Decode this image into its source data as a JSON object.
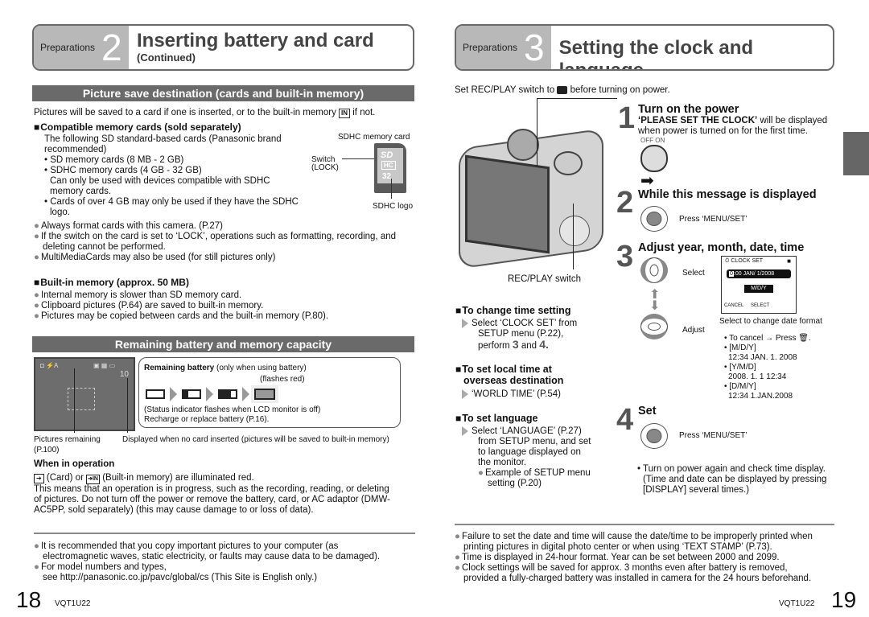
{
  "left_page": {
    "header": {
      "section": "Preparations",
      "number": "2",
      "title": "Inserting battery and card",
      "subtitle": "(Continued)"
    },
    "section1": {
      "bar": "Picture save destination (cards and built-in memory)",
      "intro": "Pictures will be saved to a card if one is inserted, or to the built-in memory",
      "intro_end": "if not.",
      "compatible_title": "Compatible memory cards (sold separately)",
      "compatible_lines": [
        "The following SD standard-based cards (Panasonic brand",
        "recommended)",
        "• SD memory cards (8 MB - 2 GB)",
        "• SDHC memory cards (4 GB - 32 GB)",
        "Can only be used with devices compatible with SDHC",
        "memory cards.",
        "• Cards of over 4 GB may only be used if they have the SDHC",
        "logo."
      ],
      "card_labels": {
        "top": "SDHC memory card",
        "switch": "Switch",
        "lock": "(LOCK)",
        "logo": "SDHC logo",
        "capacity": "32"
      },
      "notes": [
        "Always format cards with this camera. (P.27)",
        "If the switch on the card is set to ‘LOCK’, operations such as formatting, recording, and",
        "deleting cannot be performed.",
        "MultiMediaCards may also be used (for still pictures only)"
      ],
      "builtin_title": "Built-in memory (approx. 50 MB)",
      "builtin_notes": [
        "Internal memory is slower than SD memory card.",
        "Clipboard pictures (P.64) are saved to built-in memory.",
        "Pictures may be copied between cards and the built-in memory (P.80)."
      ]
    },
    "section2": {
      "bar": "Remaining battery and memory capacity",
      "lcd_count": "10",
      "battery_title": "Remaining battery",
      "battery_title_rest": "(only when using battery)",
      "flashes": "(flashes red)",
      "status_line": "(Status indicator flashes when LCD monitor is off)",
      "recharge": "Recharge or replace battery (P.16).",
      "pictures_remaining": "Pictures remaining",
      "pictures_page": "(P.100)",
      "no_card": "Displayed when no card inserted (pictures will be saved to built-in memory)",
      "operation_title": "When in operation",
      "operation_line1": "(Card) or",
      "operation_line1b": "(Built-in memory) are illuminated red.",
      "operation_text": [
        "This means that an operation is in progress, such as the recording, reading, or deleting",
        "of pictures. Do not turn off the power or remove the battery, card, or AC adaptor (DMW-",
        "AC5PP, sold separately) (this may cause damage to or loss of data)."
      ]
    },
    "footer_notes": [
      "It is recommended that you copy important pictures to your computer (as",
      "electromagnetic waves, static electricity, or faults may cause data to be damaged).",
      "For model numbers and types,",
      "see http://panasonic.co.jp/pavc/global/cs (This Site is English only.)"
    ],
    "page_number": "18",
    "model_code": "VQT1U22"
  },
  "right_page": {
    "header": {
      "section": "Preparations",
      "number": "3",
      "title": "Setting the clock and language"
    },
    "intro": "Set REC/PLAY switch to",
    "intro_end": "before turning on power.",
    "rec_play_label": "REC/PLAY switch",
    "steps": [
      {
        "num": "1",
        "title": "Turn on the power",
        "bold_text": "‘PLEASE SET THE CLOCK’",
        "text": "will be displayed",
        "text2": "when power is turned on for the first time.",
        "switch_labels": [
          "OFF",
          "ON"
        ]
      },
      {
        "num": "2",
        "title": "While this message is displayed",
        "action": "Press ‘MENU/SET’"
      },
      {
        "num": "3",
        "title": "Adjust year, month, date, time",
        "select": "Select",
        "adjust": "Adjust",
        "screen": {
          "title": "CLOCK SET",
          "value_hl": "0",
          "value": ":00  JAN/  1/2008",
          "format": "M/D/Y",
          "cancel": "CANCEL",
          "select": "SELECT"
        },
        "format_note": "Select to change date format",
        "bullets": [
          "• To cancel → Press",
          "• [M/D/Y]",
          "12:34  JAN. 1. 2008",
          "• [Y/M/D]",
          "2008. 1. 1  12:34",
          "• [D/M/Y]",
          "12:34  1.JAN.2008"
        ]
      },
      {
        "num": "4",
        "title": "Set",
        "action": "Press ‘MENU/SET’",
        "notes": [
          "• Turn on power again and check time display.",
          "(Time and date can be displayed by pressing",
          "[DISPLAY] several times.)"
        ]
      }
    ],
    "change_time": {
      "title": "To change time setting",
      "lines": [
        "Select ‘CLOCK SET’ from",
        "SETUP menu (P.22),",
        "perform"
      ],
      "perform_a": "3",
      "and": "and",
      "perform_b": "4."
    },
    "overseas": {
      "title1": "To set local time at",
      "title2": "overseas destination",
      "line": "‘WORLD TIME’ (P.54)"
    },
    "language": {
      "title": "To set language",
      "lines": [
        "Select ‘LANGUAGE’ (P.27)",
        "from SETUP menu, and set",
        "to language displayed on",
        "the monitor."
      ],
      "example": [
        "Example of SETUP menu",
        "setting (P.20)"
      ]
    },
    "footer_notes": [
      "Failure to set the date and time will cause the date/time to be improperly printed when",
      "printing pictures in digital photo center or when using ‘TEXT STAMP’ (P.73).",
      "Time is displayed in 24-hour format. Year can be set between 2000 and 2099.",
      "Clock settings will be saved for approx. 3 months even after battery is removed,",
      "provided a fully-charged battery was installed in camera for the 24 hours beforehand."
    ],
    "page_number": "19",
    "model_code": "VQT1U22"
  }
}
